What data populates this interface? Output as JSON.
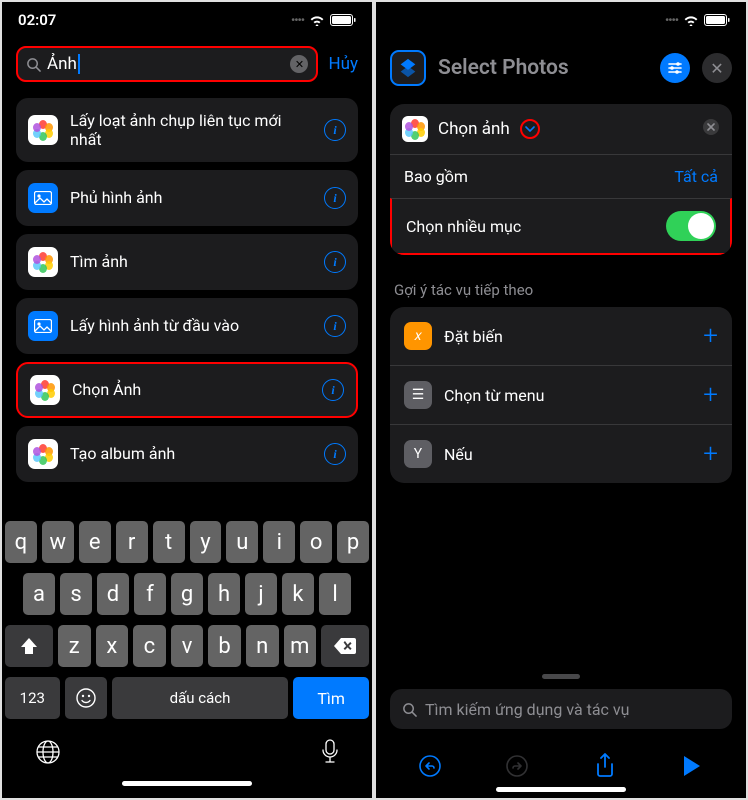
{
  "left": {
    "time": "02:07",
    "search_value": "Ảnh",
    "cancel": "Hủy",
    "actions": [
      {
        "label": "Lấy loạt ảnh chụp liên tục mới nhất",
        "icon": "photos"
      },
      {
        "label": "Phủ hình ảnh",
        "icon": "blue"
      },
      {
        "label": "Tìm ảnh",
        "icon": "photos"
      },
      {
        "label": "Lấy hình ảnh từ đầu vào",
        "icon": "blue"
      },
      {
        "label": "Chọn Ảnh",
        "icon": "photos",
        "highlight": true
      },
      {
        "label": "Tạo album ảnh",
        "icon": "photos"
      }
    ],
    "keyboard": {
      "row1": [
        "q",
        "w",
        "e",
        "r",
        "t",
        "y",
        "u",
        "i",
        "o",
        "p"
      ],
      "row2": [
        "a",
        "s",
        "d",
        "f",
        "g",
        "h",
        "j",
        "k",
        "l"
      ],
      "row3": [
        "z",
        "x",
        "c",
        "v",
        "b",
        "n",
        "m"
      ],
      "num": "123",
      "space": "dấu cách",
      "return": "Tìm"
    }
  },
  "right": {
    "header_title": "Select Photos",
    "card": {
      "title": "Chọn ảnh",
      "include_label": "Bao gồm",
      "include_value": "Tất cả",
      "multi_label": "Chọn nhiều mục"
    },
    "section_label": "Gợi ý tác vụ tiếp theo",
    "suggestions": [
      {
        "label": "Đặt biến",
        "icon": "orange",
        "glyph": "𝑥"
      },
      {
        "label": "Chọn từ menu",
        "icon": "gray",
        "glyph": "☰"
      },
      {
        "label": "Nếu",
        "icon": "gray",
        "glyph": "Y"
      }
    ],
    "bottom_search_placeholder": "Tìm kiếm ứng dụng và tác vụ"
  }
}
